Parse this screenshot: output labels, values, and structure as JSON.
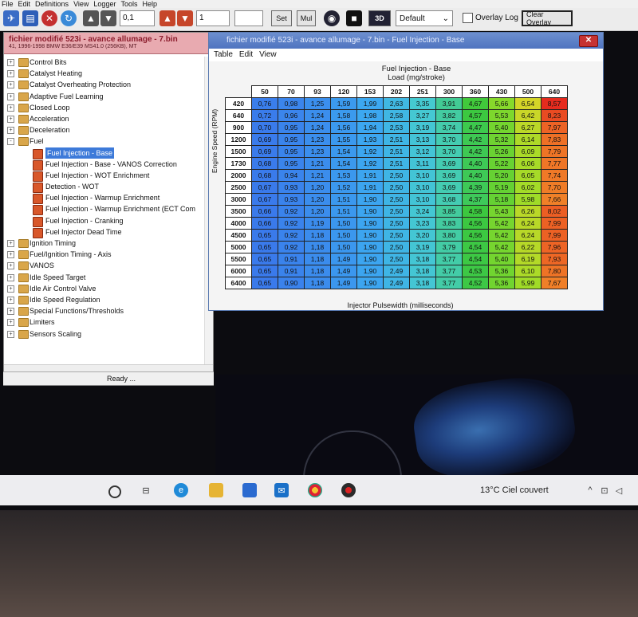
{
  "menubar": [
    "File",
    "Edit",
    "Definitions",
    "View",
    "Logger",
    "Tools",
    "Help"
  ],
  "toolbar": {
    "value1": "0,1",
    "value2": "1",
    "set_label": "Set",
    "mul_label": "Mul",
    "threed_label": "3D",
    "select_value": "Default",
    "overlay_log_label": "Overlay Log",
    "clear_overlay_label": "Clear Overlay"
  },
  "left_panel": {
    "title": "fichier modifié 523i - avance allumage - 7.bin",
    "subtitle": "41, 1996-1998 BMW E36/E39 MS41.0 (256KB), MT",
    "status": "Ready ...",
    "tree": [
      {
        "label": "Control Bits",
        "level": 0,
        "exp": "+"
      },
      {
        "label": "Catalyst Heating",
        "level": 0,
        "exp": "+"
      },
      {
        "label": "Catalyst Overheating Protection",
        "level": 0,
        "exp": "+"
      },
      {
        "label": "Adaptive Fuel Learning",
        "level": 0,
        "exp": "+"
      },
      {
        "label": "Closed Loop",
        "level": 0,
        "exp": "+"
      },
      {
        "label": "Acceleration",
        "level": 0,
        "exp": "+"
      },
      {
        "label": "Deceleration",
        "level": 0,
        "exp": "+"
      },
      {
        "label": "Fuel",
        "level": 0,
        "exp": "-"
      },
      {
        "label": "Fuel Injection - Base",
        "level": 1,
        "selected": true
      },
      {
        "label": "Fuel Injection - Base - VANOS Correction",
        "level": 1
      },
      {
        "label": "Fuel Injection - WOT Enrichment",
        "level": 1
      },
      {
        "label": "Detection - WOT",
        "level": 1
      },
      {
        "label": "Fuel Injection - Warmup Enrichment",
        "level": 1
      },
      {
        "label": "Fuel Injection - Warmup Enrichment (ECT Com",
        "level": 1
      },
      {
        "label": "Fuel Injection - Cranking",
        "level": 1
      },
      {
        "label": "Fuel Injector Dead Time",
        "level": 1
      },
      {
        "label": "Ignition Timing",
        "level": 0,
        "exp": "+"
      },
      {
        "label": "Fuel/Ignition Timing - Axis",
        "level": 0,
        "exp": "+"
      },
      {
        "label": "VANOS",
        "level": 0,
        "exp": "+"
      },
      {
        "label": "Idle Speed Target",
        "level": 0,
        "exp": "+"
      },
      {
        "label": "Idle Air Control Valve",
        "level": 0,
        "exp": "+"
      },
      {
        "label": "Idle Speed Regulation",
        "level": 0,
        "exp": "+"
      },
      {
        "label": "Special Functions/Thresholds",
        "level": 0,
        "exp": "+"
      },
      {
        "label": "Limiters",
        "level": 0,
        "exp": "+"
      },
      {
        "label": "Sensors Scaling",
        "level": 0,
        "exp": "+"
      }
    ]
  },
  "table_window": {
    "title": "fichier modifié 523i - avance allumage - 7.bin - Fuel Injection - Base",
    "menu": [
      "Table",
      "Edit",
      "View"
    ],
    "table_title": "Fuel Injection - Base",
    "x_axis_title": "Load (mg/stroke)",
    "y_axis_title": "Engine Speed (RPM)",
    "value_label": "Injector Pulsewidth (milliseconds)",
    "columns": [
      "50",
      "70",
      "93",
      "120",
      "153",
      "202",
      "251",
      "300",
      "360",
      "430",
      "500",
      "640"
    ],
    "rows": [
      "420",
      "640",
      "900",
      "1200",
      "1500",
      "1730",
      "2000",
      "2500",
      "3000",
      "3500",
      "4000",
      "4500",
      "5000",
      "5500",
      "6000",
      "6400"
    ],
    "cells": [
      [
        "0,76",
        "0,98",
        "1,25",
        "1,59",
        "1,99",
        "2,63",
        "3,35",
        "3,91",
        "4,67",
        "5,66",
        "6,54",
        "8,57"
      ],
      [
        "0,72",
        "0,96",
        "1,24",
        "1,58",
        "1,98",
        "2,58",
        "3,27",
        "3,82",
        "4,57",
        "5,53",
        "6,42",
        "8,23"
      ],
      [
        "0,70",
        "0,95",
        "1,24",
        "1,56",
        "1,94",
        "2,53",
        "3,19",
        "3,74",
        "4,47",
        "5,40",
        "6,27",
        "7,97"
      ],
      [
        "0,69",
        "0,95",
        "1,23",
        "1,55",
        "1,93",
        "2,51",
        "3,13",
        "3,70",
        "4,42",
        "5,32",
        "6,14",
        "7,83"
      ],
      [
        "0,69",
        "0,95",
        "1,23",
        "1,54",
        "1,92",
        "2,51",
        "3,12",
        "3,70",
        "4,42",
        "5,26",
        "6,09",
        "7,79"
      ],
      [
        "0,68",
        "0,95",
        "1,21",
        "1,54",
        "1,92",
        "2,51",
        "3,11",
        "3,69",
        "4,40",
        "5,22",
        "6,06",
        "7,77"
      ],
      [
        "0,68",
        "0,94",
        "1,21",
        "1,53",
        "1,91",
        "2,50",
        "3,10",
        "3,69",
        "4,40",
        "5,20",
        "6,05",
        "7,74"
      ],
      [
        "0,67",
        "0,93",
        "1,20",
        "1,52",
        "1,91",
        "2,50",
        "3,10",
        "3,69",
        "4,39",
        "5,19",
        "6,02",
        "7,70"
      ],
      [
        "0,67",
        "0,93",
        "1,20",
        "1,51",
        "1,90",
        "2,50",
        "3,10",
        "3,68",
        "4,37",
        "5,18",
        "5,98",
        "7,66"
      ],
      [
        "0,66",
        "0,92",
        "1,20",
        "1,51",
        "1,90",
        "2,50",
        "3,24",
        "3,85",
        "4,58",
        "5,43",
        "6,26",
        "8,02"
      ],
      [
        "0,66",
        "0,92",
        "1,19",
        "1,50",
        "1,90",
        "2,50",
        "3,23",
        "3,83",
        "4,56",
        "5,42",
        "6,24",
        "7,99"
      ],
      [
        "0,65",
        "0,92",
        "1,18",
        "1,50",
        "1,90",
        "2,50",
        "3,20",
        "3,80",
        "4,56",
        "5,42",
        "6,24",
        "7,99"
      ],
      [
        "0,65",
        "0,92",
        "1,18",
        "1,50",
        "1,90",
        "2,50",
        "3,19",
        "3,79",
        "4,54",
        "5,42",
        "6,22",
        "7,96"
      ],
      [
        "0,65",
        "0,91",
        "1,18",
        "1,49",
        "1,90",
        "2,50",
        "3,18",
        "3,77",
        "4,54",
        "5,40",
        "6,19",
        "7,93"
      ],
      [
        "0,65",
        "0,91",
        "1,18",
        "1,49",
        "1,90",
        "2,49",
        "3,18",
        "3,77",
        "4,53",
        "5,36",
        "6,10",
        "7,80"
      ],
      [
        "0,65",
        "0,90",
        "1,18",
        "1,49",
        "1,90",
        "2,49",
        "3,18",
        "3,77",
        "4,52",
        "5,36",
        "5,99",
        "7,67"
      ]
    ]
  },
  "taskbar": {
    "weather": "13°C  Ciel couvert"
  }
}
